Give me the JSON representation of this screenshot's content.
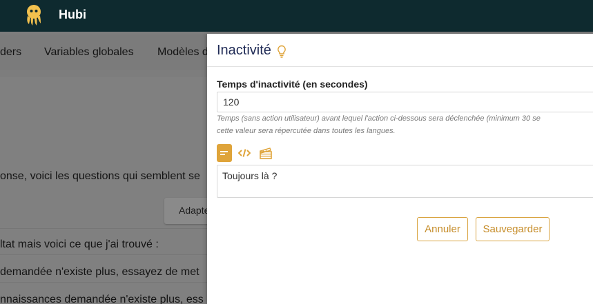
{
  "app": {
    "title": "Hubi",
    "logo_icon": "octopus-logo"
  },
  "background": {
    "nav": [
      "ders",
      "Variables globales",
      "Modèles d"
    ],
    "lines": [
      "onse, voici les questions qui semblent se",
      "ltat mais voici ce que j'ai trouvé :",
      "demandée n'existe plus, essayez de met",
      "nnaissances demandée n'existe plus, ess"
    ],
    "button_label": "Adapte"
  },
  "modal": {
    "title": "Inactivité",
    "title_icon": "lightbulb-icon",
    "field_label": "Temps d'inactivité (en secondes)",
    "field_value": "120",
    "help_line1": "Temps (sans action utilisateur) avant lequel l'action ci-dessous sera déclenchée (minimum 30 se",
    "help_line2": "cette valeur sera répercutée dans toutes les langues.",
    "editor_tabs": [
      {
        "name": "text",
        "icon": "text-lines-icon",
        "active": true
      },
      {
        "name": "code",
        "icon": "code-icon",
        "active": false
      },
      {
        "name": "media",
        "icon": "clapperboard-icon",
        "active": false
      }
    ],
    "message": "Toujours là ?",
    "cancel_label": "Annuler",
    "save_label": "Sauvegarder"
  },
  "colors": {
    "topbar": "#0e2a2f",
    "accent": "#dfa43a",
    "title": "#1f2a55",
    "overlay": "#7d7d7d"
  }
}
